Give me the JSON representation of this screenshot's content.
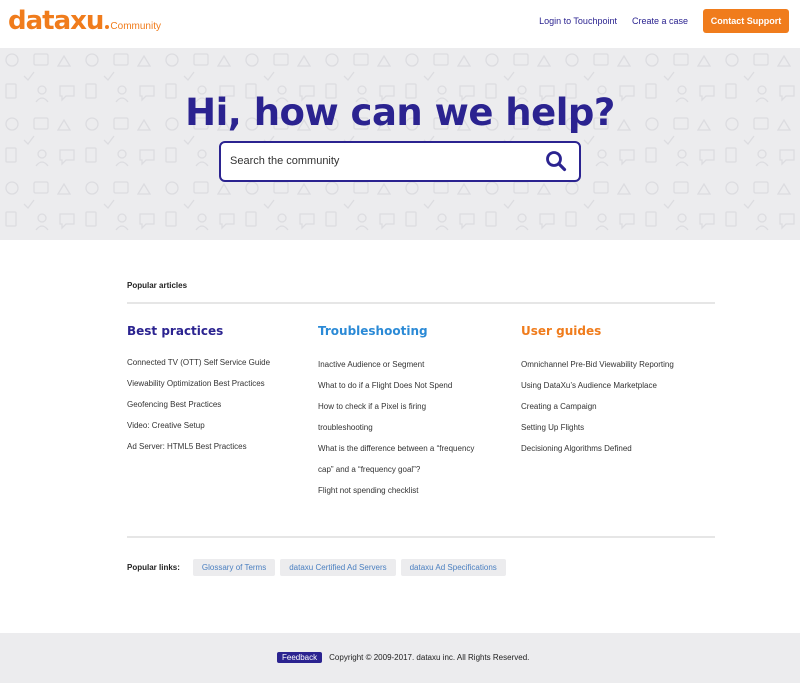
{
  "header": {
    "logo_word": "dataxu",
    "logo_sub": "Community",
    "nav": [
      {
        "label": "Login to Touchpoint"
      },
      {
        "label": "Create a case"
      }
    ],
    "support_button": "Contact Support"
  },
  "hero": {
    "title": "Hi, how can we help?",
    "search_placeholder": "Search the community"
  },
  "popular_articles": {
    "label": "Popular articles",
    "columns": [
      {
        "title": "Best practices",
        "items": [
          "Connected TV (OTT) Self Service Guide",
          "Viewability Optimization Best Practices",
          "Geofencing Best Practices",
          "Video: Creative Setup",
          "Ad Server: HTML5 Best Practices"
        ]
      },
      {
        "title": "Troubleshooting",
        "items": [
          "Inactive Audience or Segment",
          "What to do if a Flight Does Not Spend",
          "How to check if a Pixel is firing",
          "troubleshooting",
          "What is the difference between a “frequency",
          "cap” and a “frequency goal”?",
          "Flight not spending checklist"
        ]
      },
      {
        "title": "User guides",
        "items": [
          "Omnichannel Pre-Bid Viewability Reporting",
          "Using DataXu’s Audience Marketplace",
          "Creating a Campaign",
          "Setting Up Flights",
          "Decisioning Algorithms Defined"
        ]
      }
    ]
  },
  "popular_links": {
    "label": "Popular links:",
    "links": [
      "Glossary of Terms",
      "dataxu Certified Ad Servers",
      "dataxu Ad Specifications"
    ]
  },
  "footer": {
    "feedback": "Feedback",
    "copyright": "Copyright © 2009-2017. dataxu inc. All Rights Reserved."
  },
  "colors": {
    "brand_orange": "#f07c1c",
    "brand_navy": "#2b2390",
    "link_blue": "#2b8ad6",
    "hero_bg": "#ececee"
  },
  "icons": {
    "search": "search-icon",
    "hero_pattern": "background-pattern"
  }
}
